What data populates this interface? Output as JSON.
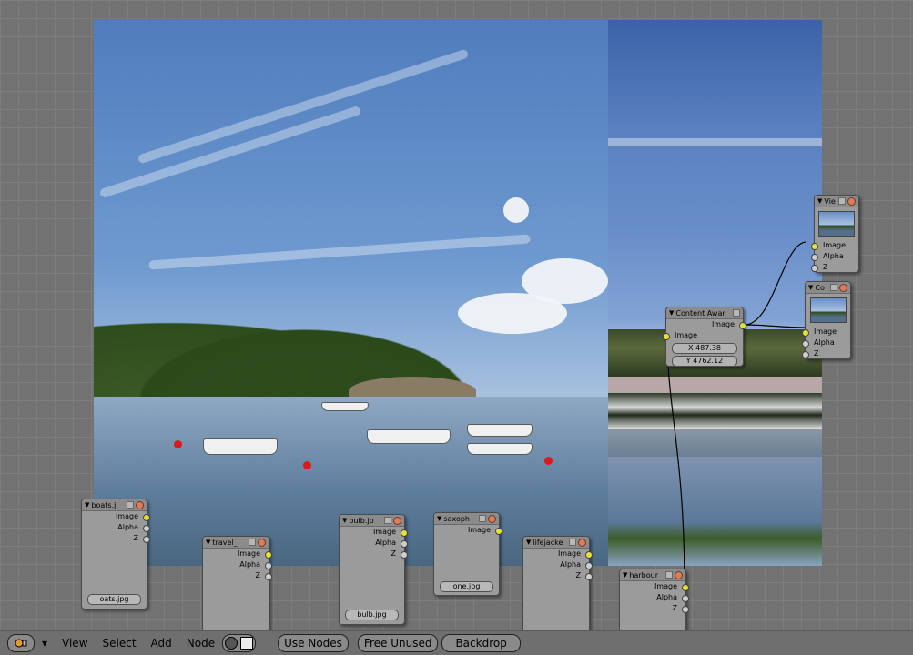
{
  "toolbar": {
    "menus": [
      "View",
      "Select",
      "Add",
      "Node"
    ],
    "use_nodes": "Use Nodes",
    "free_unused": "Free Unused",
    "backdrop": "Backdrop"
  },
  "nodes": {
    "boats": {
      "title": "boats.j",
      "outputs": [
        "Image",
        "Alpha",
        "Z"
      ],
      "file": "oats.jpg"
    },
    "travel": {
      "title": "travel_",
      "outputs": [
        "Image",
        "Alpha",
        "Z"
      ]
    },
    "bulb": {
      "title": "bulb.jp",
      "outputs": [
        "Image",
        "Alpha",
        "Z"
      ],
      "file": "bulb.jpg"
    },
    "saxoph": {
      "title": "saxoph",
      "outputs": [
        "Image"
      ],
      "file": "one.jpg"
    },
    "lifejacke": {
      "title": "lifejacke",
      "outputs": [
        "Image",
        "Alpha",
        "Z"
      ]
    },
    "harbour": {
      "title": "harbour",
      "outputs": [
        "Image",
        "Alpha",
        "Z"
      ]
    },
    "content_aware": {
      "title": "Content Awar",
      "output": "Image",
      "input": "Image",
      "x": "X 487.38",
      "y": "Y 4762.12"
    },
    "viewer": {
      "title": "Vie",
      "inputs": [
        "Image",
        "Alpha",
        "Z"
      ]
    },
    "composite": {
      "title": "Co",
      "inputs": [
        "Image",
        "Alpha",
        "Z"
      ]
    }
  },
  "colors": {
    "socket_image": "#e5e03a",
    "socket_other": "#cfcfcf",
    "close": "#e07a58"
  }
}
